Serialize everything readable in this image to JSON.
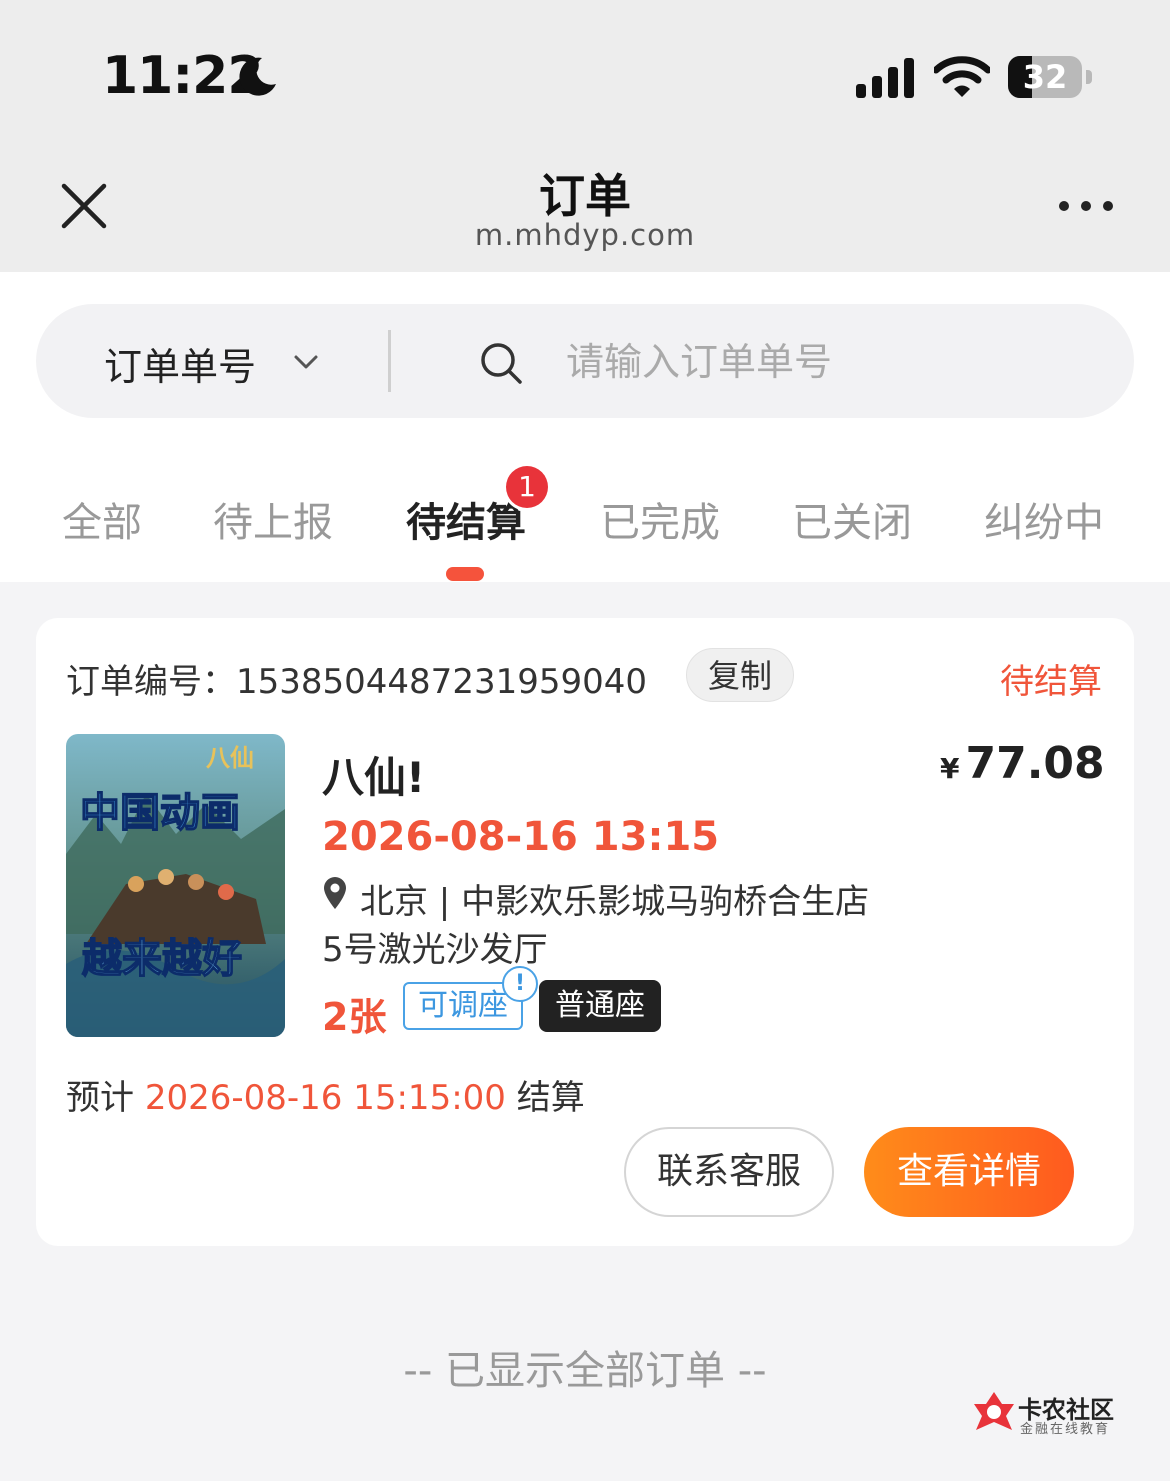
{
  "status_bar": {
    "time": "11:22",
    "battery": "32",
    "battery_level": 0.32
  },
  "nav": {
    "title": "订单",
    "url": "m.mhdyp.com"
  },
  "search": {
    "type_label": "订单单号",
    "placeholder": "请输入订单单号",
    "value": ""
  },
  "tabs": [
    {
      "label": "全部",
      "active": false
    },
    {
      "label": "待上报",
      "active": false
    },
    {
      "label": "待结算",
      "active": true,
      "badge": "1"
    },
    {
      "label": "已完成",
      "active": false
    },
    {
      "label": "已关闭",
      "active": false
    },
    {
      "label": "纠纷中",
      "active": false
    }
  ],
  "order": {
    "number_label": "订单编号：",
    "number": "1538504487231959040",
    "copy_label": "复制",
    "status": "待结算",
    "poster": {
      "logo_text": "八仙",
      "top_text": "中国动画",
      "bottom_text": "越来越好"
    },
    "movie_title": "八仙!",
    "currency": "¥",
    "price": "77.08",
    "showtime": "2026-08-16 13:15",
    "cinema": "北京 | 中影欢乐影城马驹桥合生店",
    "hall": "5号激光沙发厅",
    "tickets": "2张",
    "seat_tag": "可调座",
    "seat_info_mark": "!",
    "seat_type": "普通座",
    "settle_prefix": "预计",
    "settle_time": "2026-08-16 15:15:00",
    "settle_suffix": "结算",
    "contact_label": "联系客服",
    "detail_label": "查看详情"
  },
  "footer": {
    "end_note": "-- 已显示全部订单 --"
  },
  "watermark": {
    "name": "卡农社区",
    "sub": "金融在线教育"
  },
  "colors": {
    "accent": "#f0553a",
    "badge": "#e8333a",
    "tag_blue": "#3c97e0",
    "button_gradient": [
      "#ff8c1a",
      "#ff5a1f"
    ]
  }
}
